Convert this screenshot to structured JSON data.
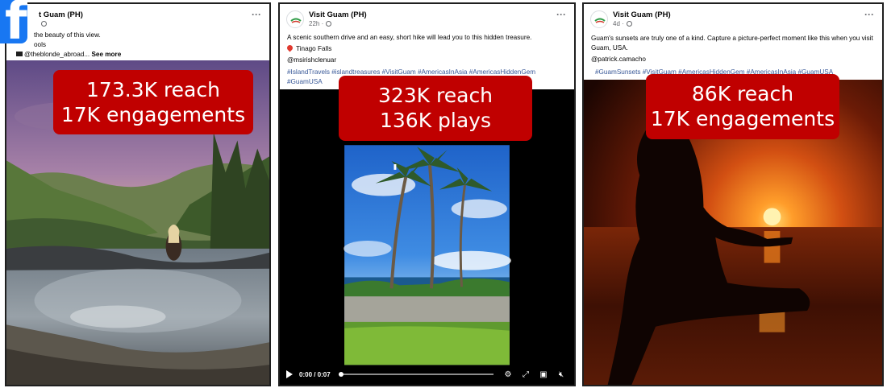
{
  "posts": [
    {
      "page_name": "t Guam (PH)",
      "meta": "",
      "caption_lines": [
        "the beauty of this view.",
        "ools",
        "@theblonde_abroad..."
      ],
      "see_more": "See more",
      "stats": [
        "173.3K reach",
        "17K engagements"
      ],
      "media_icon": "natural-pool-photo"
    },
    {
      "page_name": "Visit Guam (PH)",
      "meta": "22h ·",
      "caption": "A scenic southern drive and an easy, short hike will lead you to this hidden treasure.",
      "location": "Tinago Falls",
      "handle": "@msirishclenuar",
      "hashtags_line1": "#IslandTravels #islandtreasures #VisitGuam #AmericasInAsia #AmericasHiddenGem",
      "hashtags_line2": "#GuamUSA",
      "stats": [
        "323K reach",
        "136K plays"
      ],
      "video_time": "0:00 / 0:07",
      "media_icon": "palm-trees-video"
    },
    {
      "page_name": "Visit Guam (PH)",
      "meta": "4d ·",
      "caption": "Guam's sunsets are truly one of a kind. Capture a picture-perfect moment like this when you visit Guam, USA.",
      "handle": "@patrick.camacho",
      "hashtags": "#GuamSunsets #VisitGuam #AmericasHiddenGem #AmericasInAsia #GuamUSA",
      "stats": [
        "86K reach",
        "17K engagements"
      ],
      "media_icon": "sunset-silhouette-photo"
    }
  ],
  "colors": {
    "stat_box": "#c00000",
    "facebook_blue": "#1877f2",
    "link": "#385898"
  },
  "icons": {
    "more": "more-options-icon",
    "globe": "globe-icon",
    "pin": "pin-icon",
    "play": "play-icon",
    "settings": "gear-icon",
    "fullscreen": "expand-icon",
    "pip": "picture-in-picture-icon",
    "mute": "mute-icon",
    "facebook": "facebook-logo"
  }
}
